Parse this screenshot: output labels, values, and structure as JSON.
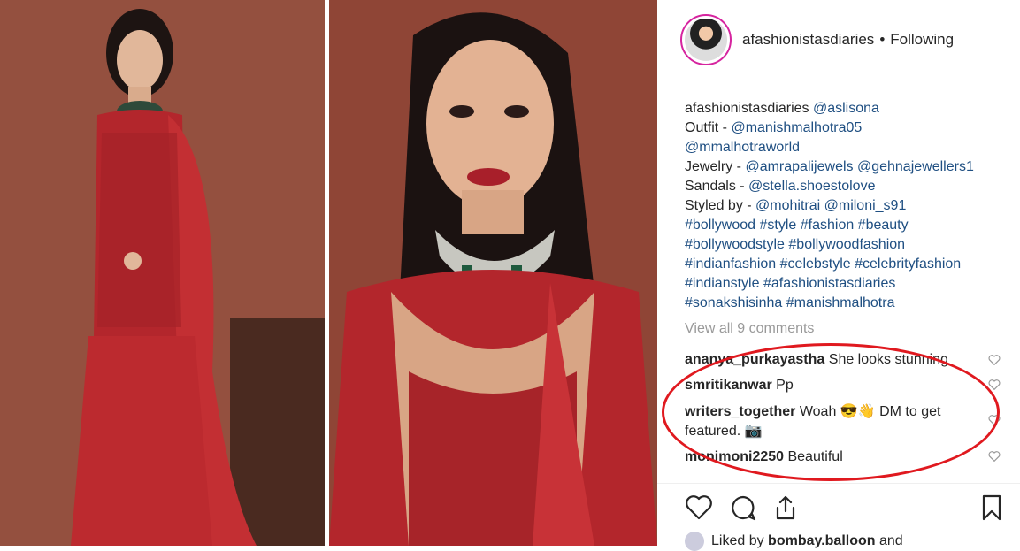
{
  "post": {
    "username": "afashionistasdiaries",
    "separator": "•",
    "follow_status": "Following"
  },
  "caption": {
    "user": "afashionistasdiaries",
    "lines": [
      {
        "prefix": "",
        "links": "@aslisona"
      },
      {
        "prefix": "Outfit - ",
        "links": "@manishmalhotra05"
      },
      {
        "prefix": "",
        "links": "@mmalhotraworld"
      },
      {
        "prefix": "Jewelry - ",
        "links": "@amrapalijewels @gehnajewellers1"
      },
      {
        "prefix": "Sandals - ",
        "links": "@stella.shoestolove"
      },
      {
        "prefix": "Styled by - ",
        "links": "@mohitrai @miloni_s91"
      },
      {
        "prefix": "",
        "links": "#bollywood #style #fashion #beauty"
      },
      {
        "prefix": "",
        "links": "#bollywoodstyle #bollywoodfashion"
      },
      {
        "prefix": "",
        "links": "#indianfashion #celebstyle #celebrityfashion"
      },
      {
        "prefix": "",
        "links": "#indianstyle #afashionistasdiaries"
      },
      {
        "prefix": "",
        "links": "#sonakshisinha #manishmalhotra"
      }
    ]
  },
  "comments_link": "View all 9 comments",
  "comments": [
    {
      "user": "ananya_purkayastha",
      "text": "She looks stunning"
    },
    {
      "user": "smritikanwar",
      "text": "Pp"
    },
    {
      "user": "writers_together",
      "text": "Woah 😎👋 DM to get featured. 📷"
    },
    {
      "user": "monimoni2250",
      "text": "Beautiful"
    }
  ],
  "likes": {
    "prefix": "Liked by",
    "user": "bombay.balloon",
    "suffix": "and"
  },
  "icons": {
    "like": "heart-icon",
    "comment": "comment-icon",
    "share": "share-icon",
    "save": "bookmark-icon"
  },
  "colors": {
    "link": "#1f4f82",
    "annotation": "#e0191f",
    "dress": "#b3262c"
  }
}
